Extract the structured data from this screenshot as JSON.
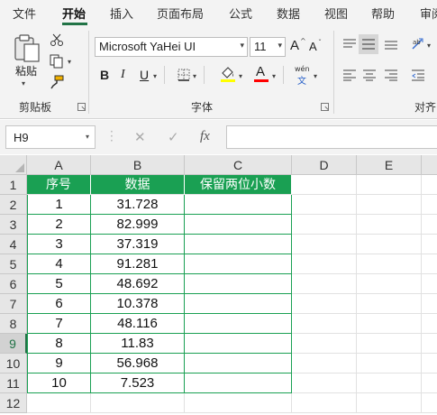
{
  "tabs": [
    "文件",
    "开始",
    "插入",
    "页面布局",
    "公式",
    "数据",
    "视图",
    "帮助",
    "审阅"
  ],
  "ribbon": {
    "paste_label": "粘贴",
    "clipboard_label": "剪贴板",
    "font_group_label": "字体",
    "align_group_label": "对齐",
    "font_name": "Microsoft YaHei UI",
    "font_size": "11",
    "bold": "B",
    "italic": "I",
    "underline": "U",
    "phonetic": "wén",
    "phonetic_char": "文",
    "increase_font": "A",
    "decrease_font": "A",
    "font_color_letter": "A",
    "colors": {
      "accent": "#217346",
      "fill_highlight": "#ffff00",
      "font_color": "#ff0000",
      "table_header": "#1aa053"
    }
  },
  "formula_bar": {
    "name_box": "H9",
    "cancel": "✕",
    "enter": "✓",
    "fx": "fx",
    "formula": ""
  },
  "columns": [
    "A",
    "B",
    "C",
    "D",
    "E"
  ],
  "rows": [
    "1",
    "2",
    "3",
    "4",
    "5",
    "6",
    "7",
    "8",
    "9",
    "10",
    "11",
    "12"
  ],
  "table": {
    "headers": [
      "序号",
      "数据",
      "保留两位小数"
    ],
    "rows": [
      [
        "1",
        "31.728",
        ""
      ],
      [
        "2",
        "82.999",
        ""
      ],
      [
        "3",
        "37.319",
        ""
      ],
      [
        "4",
        "91.281",
        ""
      ],
      [
        "5",
        "48.692",
        ""
      ],
      [
        "6",
        "10.378",
        ""
      ],
      [
        "7",
        "48.116",
        ""
      ],
      [
        "8",
        "11.83",
        ""
      ],
      [
        "9",
        "56.968",
        ""
      ],
      [
        "10",
        "7.523",
        ""
      ]
    ]
  },
  "selected_cell": "H9",
  "selected_row": "9"
}
